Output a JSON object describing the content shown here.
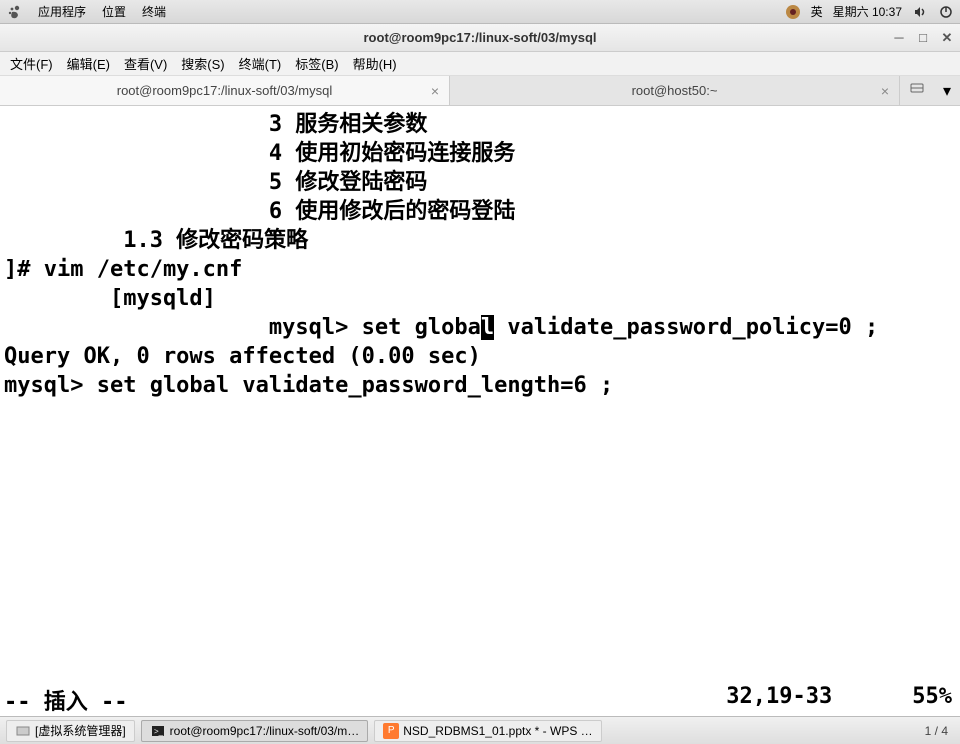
{
  "topbar": {
    "menus": [
      "应用程序",
      "位置",
      "终端"
    ],
    "ime": "英",
    "datetime": "星期六 10:37"
  },
  "window": {
    "title": "root@room9pc17:/linux-soft/03/mysql"
  },
  "menubar": {
    "items": [
      "文件(F)",
      "编辑(E)",
      "查看(V)",
      "搜索(S)",
      "终端(T)",
      "标签(B)",
      "帮助(H)"
    ]
  },
  "tabs": {
    "items": [
      {
        "label": "root@room9pc17:/linux-soft/03/mysql",
        "active": true
      },
      {
        "label": "root@host50:~",
        "active": false
      }
    ]
  },
  "terminal": {
    "lines": [
      "                    3 服务相关参数",
      "                    4 使用初始密码连接服务",
      "                    5 修改登陆密码",
      "                    6 使用修改后的密码登陆",
      "",
      "         1.3 修改密码策略",
      "",
      "",
      "",
      "]# vim /etc/my.cnf",
      "        [mysqld]"
    ],
    "cursor_line_pre": "                    mysql> set globa",
    "cursor_char": "l",
    "cursor_line_post": " validate_password_policy=0 ;",
    "after_lines": [
      "Query OK, 0 rows affected (0.00 sec)",
      "",
      "mysql> set global validate_password_length=6 ;",
      "",
      "",
      "",
      ""
    ],
    "mode": "-- 插入 --",
    "position": "32,19-33",
    "percent": "55%"
  },
  "taskbar": {
    "items": [
      {
        "label": "[虚拟系统管理器]",
        "icon": "vm"
      },
      {
        "label": "root@room9pc17:/linux-soft/03/m…",
        "icon": "term"
      },
      {
        "label": "NSD_RDBMS1_01.pptx * - WPS …",
        "icon": "wps"
      }
    ],
    "workspace": "1 / 4"
  }
}
